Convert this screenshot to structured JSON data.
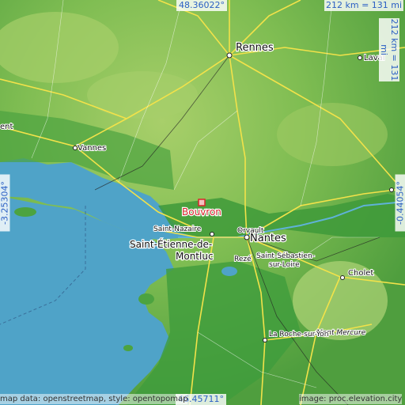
{
  "map": {
    "place_name": "Bouvron",
    "coords": {
      "lat_top": "48.36022°",
      "lat_bottom": "46.45711°",
      "lon_left": "-3.25304°",
      "lon_right": "-0.44054°"
    },
    "scale": {
      "horizontal": "212 km = 131 mi",
      "vertical": "212 km = 131 mi"
    },
    "attribution": {
      "left": "map data: openstreetmap, style: opentopomap",
      "right": "image: proc.elevation.city"
    },
    "cities": {
      "rennes": "Rennes",
      "vannes": "Vannes",
      "laval": "Laval",
      "nantes": "Nantes",
      "orvault": "Orvault",
      "reze": "Rezé",
      "saint_nazaire": "Saint-Nazaire",
      "saint_etienne_1": "Saint-Étienne-de-",
      "saint_etienne_2": "Montluc",
      "saint_sebastien_1": "Saint-Sébastien-",
      "saint_sebastien_2": "sur-Loire",
      "cholet": "Cholet",
      "mont_mercure": "Mont Mercure",
      "la_roche": "La Roche-sur-Yon",
      "lorient_partial": "ent"
    },
    "colors": {
      "sea": "#4fa3c8",
      "lowland": "#3e9a3a",
      "highland": "#9cc960",
      "road": "#f2e24a",
      "marker": "#d9242a"
    }
  }
}
